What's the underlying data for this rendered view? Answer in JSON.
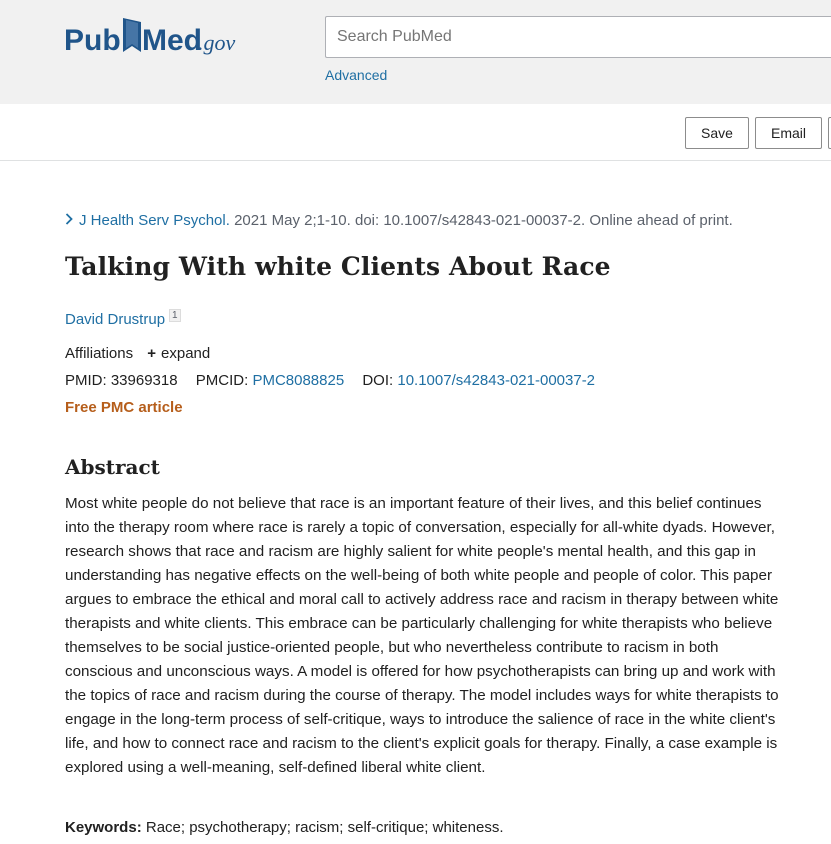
{
  "header": {
    "logo": {
      "pub": "Pub",
      "med": "Med",
      "gov": ".gov"
    },
    "search": {
      "placeholder": "Search PubMed"
    },
    "advanced_label": "Advanced"
  },
  "toolbar": {
    "save_label": "Save",
    "email_label": "Email"
  },
  "article": {
    "citation": {
      "journal": "J Health Serv Psychol.",
      "details": " 2021 May 2;1-10. doi: 10.1007/s42843-021-00037-2. Online ahead of print."
    },
    "title": "Talking With white Clients About Race",
    "author": {
      "name": "David Drustrup",
      "affiliation_number": "1"
    },
    "affiliations_label": "Affiliations",
    "expand_label": "expand",
    "ids": {
      "pmid_label": "PMID:",
      "pmid": "33969318",
      "pmcid_label": "PMCID:",
      "pmcid": "PMC8088825",
      "doi_label": "DOI:",
      "doi": "10.1007/s42843-021-00037-2"
    },
    "free_pmc_label": "Free PMC article",
    "abstract_heading": "Abstract",
    "abstract": "Most white people do not believe that race is an important feature of their lives, and this belief continues into the therapy room where race is rarely a topic of conversation, especially for all-white dyads. However, research shows that race and racism are highly salient for white people's mental health, and this gap in understanding has negative effects on the well-being of both white people and people of color. This paper argues to embrace the ethical and moral call to actively address race and racism in therapy between white therapists and white clients. This embrace can be particularly challenging for white therapists who believe themselves to be social justice-oriented people, but who nevertheless contribute to racism in both conscious and unconscious ways. A model is offered for how psychotherapists can bring up and work with the topics of race and racism during the course of therapy. The model includes ways for white therapists to engage in the long-term process of self-critique, ways to introduce the salience of race in the white client's life, and how to connect race and racism to the client's explicit goals for therapy. Finally, a case example is explored using a well-meaning, self-defined liberal white client.",
    "keywords_label": "Keywords:",
    "keywords": " Race; psychotherapy; racism; self-critique; whiteness."
  },
  "colors": {
    "link": "#1f6fa3",
    "logo_blue": "#20558a",
    "free_pmc": "#b65e1b"
  }
}
